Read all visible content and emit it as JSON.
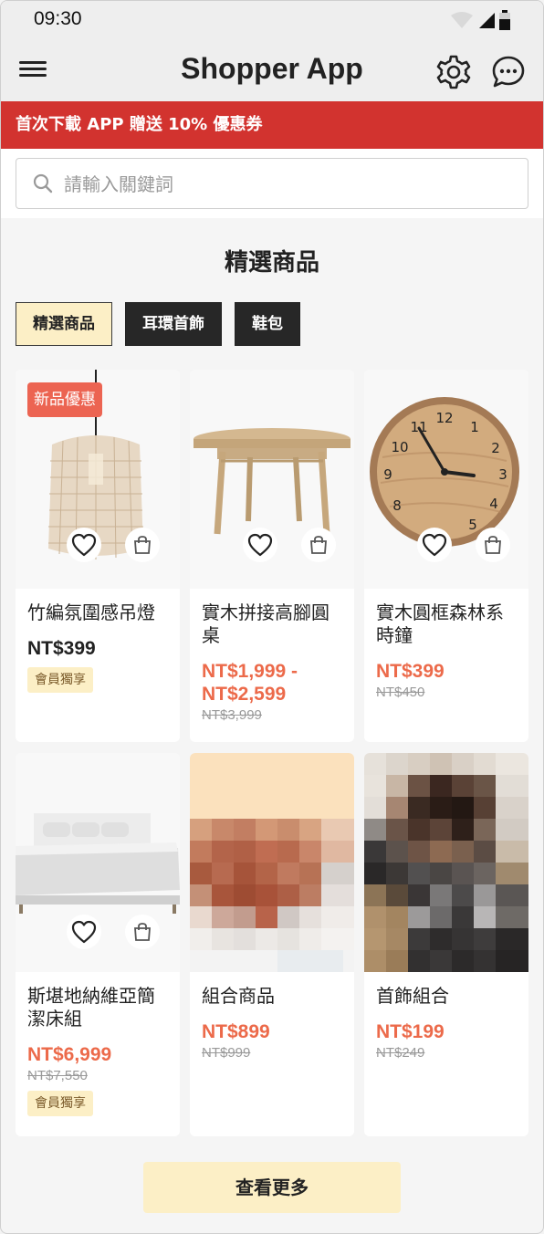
{
  "status_bar": {
    "time": "09:30"
  },
  "app": {
    "title": "Shopper App",
    "menu_icon": "hamburger-menu-icon",
    "settings_icon": "gear-icon",
    "chat_icon": "chat-bubble-icon"
  },
  "banner": {
    "text": "首次下載 APP 贈送 10% 優惠券",
    "color": "#d2332f"
  },
  "search": {
    "placeholder": "請輸入關鍵詞",
    "value": ""
  },
  "section": {
    "title": "精選商品"
  },
  "tabs": [
    {
      "label": "精選商品",
      "active": true
    },
    {
      "label": "耳環首飾",
      "active": false
    },
    {
      "label": "鞋包",
      "active": false
    }
  ],
  "products": [
    {
      "name": "竹編氛圍感吊燈",
      "price": "NT$399",
      "original_price": "",
      "badge": "新品優惠",
      "member": "會員獨享",
      "image": "rattan-pendant-lamp"
    },
    {
      "name": "實木拼接高腳圓桌",
      "price": "NT$1,999 - NT$2,599",
      "original_price": "NT$3,999",
      "badge": "",
      "member": "",
      "image": "wooden-round-table"
    },
    {
      "name": "實木圓框森林系時鐘",
      "price": "NT$399",
      "original_price": "NT$450",
      "badge": "",
      "member": "",
      "image": "wooden-wall-clock"
    },
    {
      "name": "斯堪地納維亞簡潔床組",
      "price": "NT$6,999",
      "original_price": "NT$7,550",
      "badge": "",
      "member": "會員獨享",
      "image": "white-bed"
    },
    {
      "name": "組合商品",
      "price": "NT$899",
      "original_price": "NT$999",
      "badge": "",
      "member": "",
      "image": "pixelated-bundle"
    },
    {
      "name": "首飾組合",
      "price": "NT$199",
      "original_price": "NT$249",
      "badge": "",
      "member": "",
      "image": "pixelated-jewelry"
    }
  ],
  "more_button": {
    "label": "查看更多"
  },
  "colors": {
    "sale": "#ec6a4a",
    "accent_bg": "#fcefc6",
    "tab_dark": "#272727"
  }
}
